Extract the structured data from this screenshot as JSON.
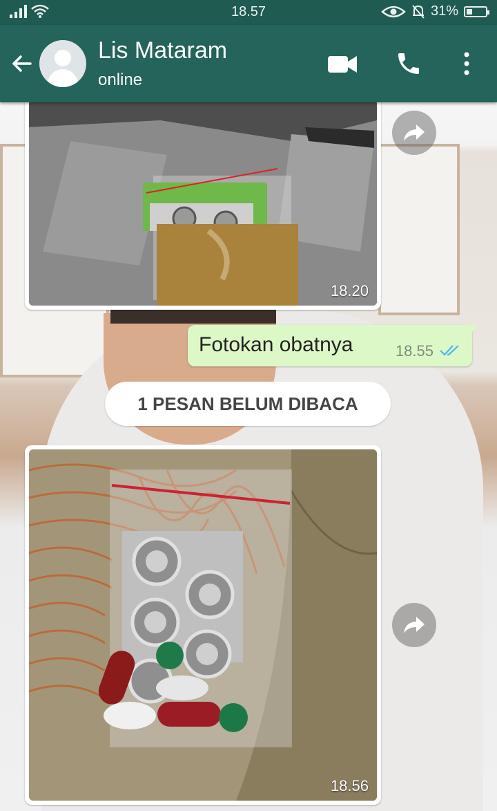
{
  "status_bar": {
    "time": "18.57",
    "battery": "31%",
    "battery_level": 0.31
  },
  "header": {
    "contact_name": "Lis Mataram",
    "contact_status": "online"
  },
  "icons": {
    "back": "arrow-left-icon",
    "video": "video-call-icon",
    "call": "phone-icon",
    "menu": "more-vert-icon",
    "forward": "forward-icon"
  },
  "messages": [
    {
      "type": "image",
      "direction": "incoming",
      "time": "18.20"
    },
    {
      "type": "text",
      "direction": "outgoing",
      "text": "Fotokan obatnya",
      "time": "18.55",
      "status": "read"
    },
    {
      "type": "image",
      "direction": "incoming",
      "time": "18.56"
    }
  ],
  "unread_banner": "1 PESAN BELUM DIBACA",
  "colors": {
    "header": "#24645a",
    "status_bar": "#1f5b50",
    "outgoing_bubble": "#dcf8c6",
    "read_ticks": "#4fb6ec"
  }
}
